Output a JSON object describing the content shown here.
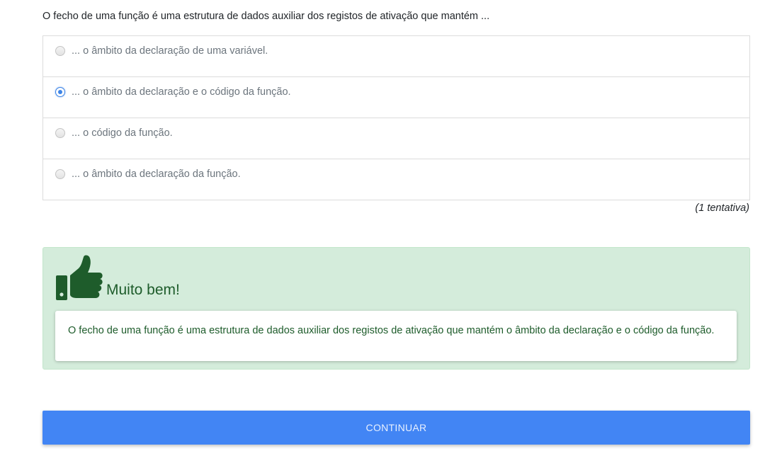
{
  "question": {
    "text": "O fecho de uma função é uma estrutura de dados auxiliar dos registos de ativação que mantém ..."
  },
  "options": [
    {
      "label": "... o âmbito da declaração de uma variável.",
      "selected": false
    },
    {
      "label": "... o âmbito da declaração e o código da função.",
      "selected": true
    },
    {
      "label": "... o código da função.",
      "selected": false
    },
    {
      "label": "... o âmbito da declaração da função.",
      "selected": false
    }
  ],
  "attempts": "(1 tentativa)",
  "feedback": {
    "icon": "thumbs-up-icon",
    "title": "Muito bem!",
    "text": "O fecho de uma função é uma estrutura de dados auxiliar dos registos de ativação que mantém o âmbito da declaração e o código da função.",
    "colors": {
      "background": "#d4ecdb",
      "text": "#1e5c2b"
    }
  },
  "continue_button": {
    "label": "CONTINUAR",
    "color": "#4285f4"
  }
}
